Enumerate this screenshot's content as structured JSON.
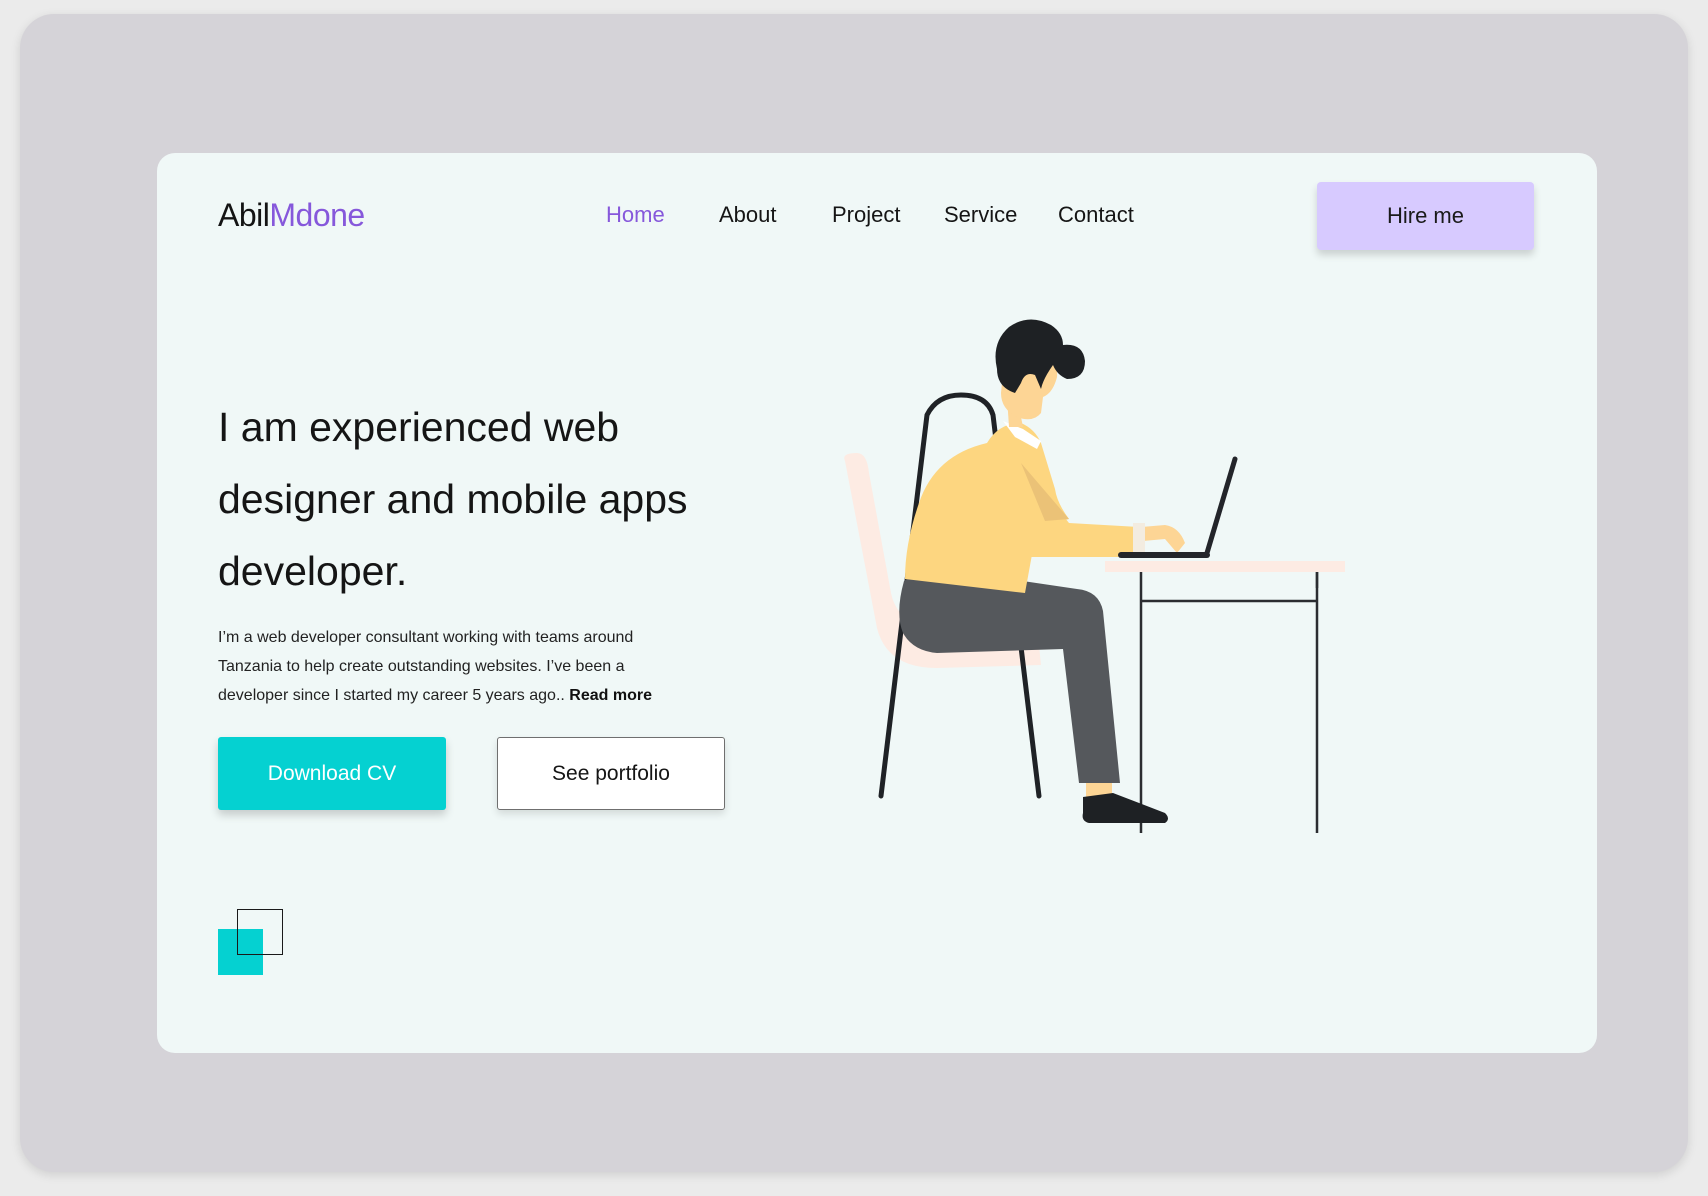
{
  "header": {
    "logo_primary": "Abil",
    "logo_accent": "Mdone",
    "nav": [
      {
        "label": "Home",
        "active": true
      },
      {
        "label": "About",
        "active": false
      },
      {
        "label": "Project",
        "active": false
      },
      {
        "label": "Service",
        "active": false
      },
      {
        "label": "Contact",
        "active": false
      }
    ],
    "hire_label": "Hire me"
  },
  "hero": {
    "title": "I am experienced web designer and mobile apps developer.",
    "paragraph": "I’m a web developer consultant working with teams around Tanzania to help create outstanding websites. I’ve been a developer since I started my career 5 years ago..",
    "read_more": "Read more",
    "download_label": "Download CV",
    "portfolio_label": "See portfolio"
  },
  "illustration": {
    "name": "developer-at-laptop-illustration",
    "colors": {
      "hair": "#1e2124",
      "skin": "#fdd595",
      "sweater": "#fdd680",
      "sweater_shade": "#ebc277",
      "pants": "#55585c",
      "chair_seat": "#fdebe3",
      "chair_frame": "#1f2226",
      "table_top": "#fdebe3",
      "table_frame": "#2b2d31",
      "laptop": "#23252a",
      "shoe": "#1e2124"
    }
  },
  "colors": {
    "accent_purple": "#8658db",
    "teal": "#05d1d1",
    "hire_bg": "#d7caff",
    "card_bg": "#f0f8f7",
    "frame_bg": "#d5d3d8"
  }
}
